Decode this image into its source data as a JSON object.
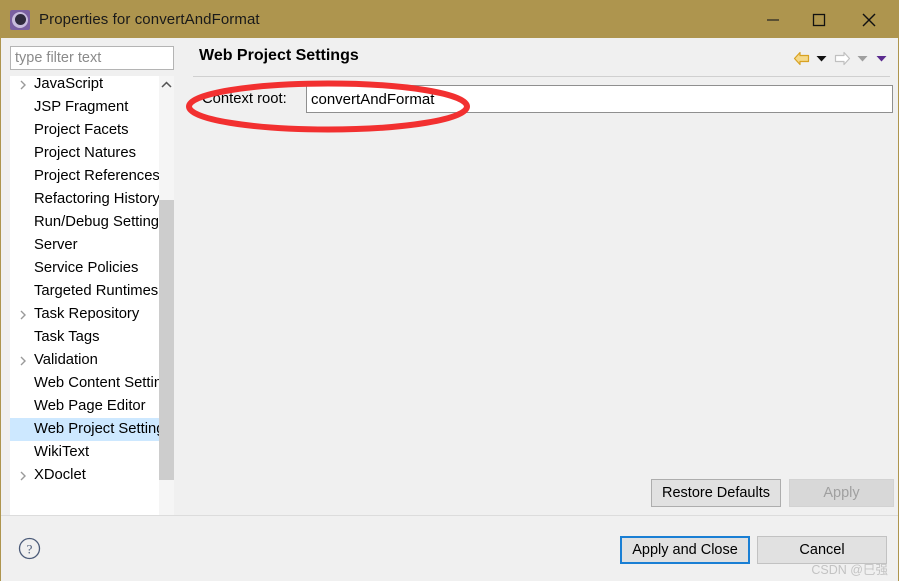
{
  "window": {
    "title": "Properties for convertAndFormat",
    "icon": "eclipse-properties-icon",
    "minimize_label": "—",
    "maximize_label": "□",
    "close_label": "✕",
    "titlebar_color": "#ae954e"
  },
  "sidebar": {
    "filter": {
      "placeholder": "type filter text",
      "value": ""
    },
    "items": [
      {
        "label": "JavaScript",
        "expandable": true,
        "selected": false
      },
      {
        "label": "JSP Fragment",
        "expandable": false,
        "selected": false
      },
      {
        "label": "Project Facets",
        "expandable": false,
        "selected": false
      },
      {
        "label": "Project Natures",
        "expandable": false,
        "selected": false
      },
      {
        "label": "Project References",
        "expandable": false,
        "selected": false
      },
      {
        "label": "Refactoring History",
        "expandable": false,
        "selected": false
      },
      {
        "label": "Run/Debug Settings",
        "expandable": false,
        "selected": false
      },
      {
        "label": "Server",
        "expandable": false,
        "selected": false
      },
      {
        "label": "Service Policies",
        "expandable": false,
        "selected": false
      },
      {
        "label": "Targeted Runtimes",
        "expandable": false,
        "selected": false
      },
      {
        "label": "Task Repository",
        "expandable": true,
        "selected": false
      },
      {
        "label": "Task Tags",
        "expandable": false,
        "selected": false
      },
      {
        "label": "Validation",
        "expandable": true,
        "selected": false
      },
      {
        "label": "Web Content Settings",
        "expandable": false,
        "selected": false
      },
      {
        "label": "Web Page Editor",
        "expandable": false,
        "selected": false
      },
      {
        "label": "Web Project Settings",
        "expandable": false,
        "selected": true
      },
      {
        "label": "WikiText",
        "expandable": false,
        "selected": false
      },
      {
        "label": "XDoclet",
        "expandable": true,
        "selected": false
      }
    ],
    "selection_color": "#cde8ff"
  },
  "main": {
    "page_title": "Web Project Settings",
    "nav": {
      "back_icon": "back-arrow-icon",
      "back_menu_icon": "chevron-down-icon",
      "forward_icon": "forward-arrow-icon",
      "forward_menu_icon": "chevron-down-icon",
      "view_menu_icon": "chevron-down-icon",
      "back_color": "#e8b33c",
      "forward_color": "#c8c8c8",
      "view_menu_color": "#6a2f9c"
    },
    "context_root": {
      "label": "Context root:",
      "value": "convertAndFormat",
      "placeholder": ""
    },
    "restore_defaults_label": "Restore Defaults",
    "apply_label": "Apply",
    "apply_enabled": false
  },
  "footer": {
    "help_icon": "question-mark-icon",
    "apply_and_close_label": "Apply and Close",
    "cancel_label": "Cancel",
    "focus_color": "#1a7fd4",
    "watermark": "CSDN @巳强"
  },
  "annotation": {
    "shape": "ellipse",
    "color": "#f23030",
    "target": "Context root field"
  }
}
